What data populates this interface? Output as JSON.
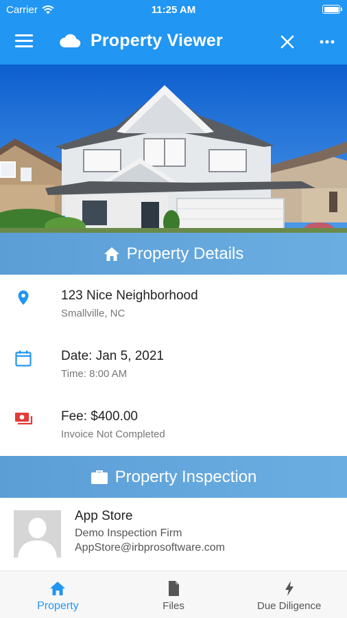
{
  "status_bar": {
    "carrier": "Carrier",
    "time": "11:25 AM"
  },
  "app_bar": {
    "title": "Property Viewer",
    "icons": [
      "menu-icon",
      "cloud-icon",
      "close-icon",
      "more-icon"
    ]
  },
  "sections": {
    "details_title": "Property Details",
    "inspection_title": "Property Inspection"
  },
  "details": {
    "address": {
      "primary": "123 Nice Neighborhood",
      "secondary": "Smallville, NC",
      "icon": "location-pin-icon"
    },
    "date": {
      "primary": "Date: Jan 5, 2021",
      "secondary": "Time: 8:00 AM",
      "icon": "calendar-icon"
    },
    "fee": {
      "primary": "Fee: $400.00",
      "secondary": "Invoice Not Completed",
      "icon": "money-icon"
    }
  },
  "inspection": {
    "name": "App Store",
    "firm": "Demo Inspection Firm",
    "email": "AppStore@irbprosoftware.com"
  },
  "tabs": [
    {
      "label": "Property",
      "icon": "home-icon",
      "active": true
    },
    {
      "label": "Files",
      "icon": "file-icon",
      "active": false
    },
    {
      "label": "Due Diligence",
      "icon": "lightning-icon",
      "active": false
    }
  ],
  "colors": {
    "primary": "#2196f3",
    "fee_icon": "#e53935",
    "header": "#5fa3da"
  }
}
